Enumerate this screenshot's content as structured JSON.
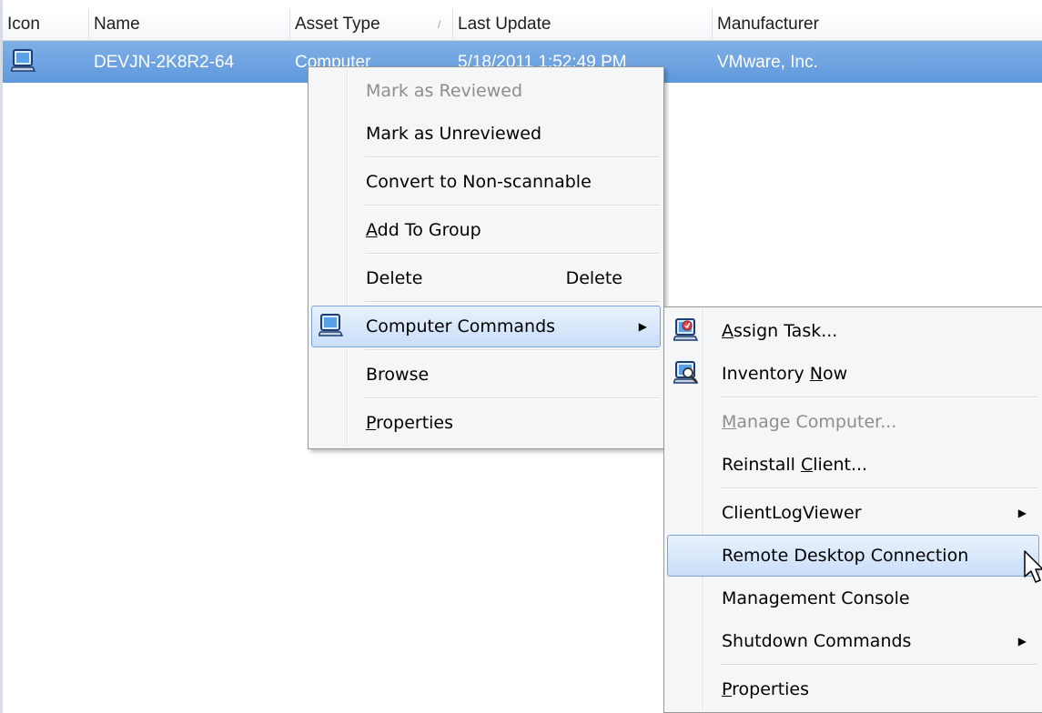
{
  "listview": {
    "columns": [
      {
        "key": "icon",
        "label": "Icon"
      },
      {
        "key": "name",
        "label": "Name"
      },
      {
        "key": "asset_type",
        "label": "Asset Type"
      },
      {
        "key": "last_update",
        "label": "Last Update"
      },
      {
        "key": "manufacturer",
        "label": "Manufacturer"
      }
    ],
    "sort_indicator": "/",
    "rows": [
      {
        "icon": "computer-icon",
        "name": "DEVJN-2K8R2-64",
        "asset_type": "Computer",
        "last_update": "5/18/2011 1:52:49 PM",
        "manufacturer": "VMware, Inc.",
        "selected": true
      }
    ]
  },
  "context_menu": {
    "items": [
      {
        "label": "Mark as Reviewed",
        "disabled": true
      },
      {
        "label": "Mark as Unreviewed"
      },
      {
        "label": "Convert to Non-scannable"
      },
      {
        "label": "Add To Group",
        "mnemonic": "A"
      },
      {
        "label": "Delete",
        "shortcut": "Delete"
      },
      {
        "label": "Computer Commands",
        "icon": "computer-icon",
        "has_submenu": true,
        "highlighted": true
      },
      {
        "label": "Browse"
      },
      {
        "label": "Properties",
        "mnemonic": "P"
      }
    ]
  },
  "submenu": {
    "items": [
      {
        "label": "Assign Task...",
        "mnemonic": "A",
        "icon": "assign-task-icon"
      },
      {
        "label": "Inventory Now",
        "mnemonic": "N",
        "icon": "inventory-now-icon"
      },
      {
        "label": "Manage Computer...",
        "mnemonic": "M",
        "disabled": true
      },
      {
        "label": "Reinstall Client...",
        "mnemonic": "C"
      },
      {
        "label": "ClientLogViewer",
        "has_submenu": true
      },
      {
        "label": "Remote Desktop Connection",
        "highlighted": true
      },
      {
        "label": "Management Console"
      },
      {
        "label": "Shutdown Commands",
        "has_submenu": true
      },
      {
        "label": "Properties",
        "mnemonic": "P"
      }
    ]
  },
  "colors": {
    "selection": "#6aa0de",
    "menu_background": "#f5f6f7",
    "highlight_border": "#7ca4d6",
    "disabled_text": "#8d8d8d"
  }
}
